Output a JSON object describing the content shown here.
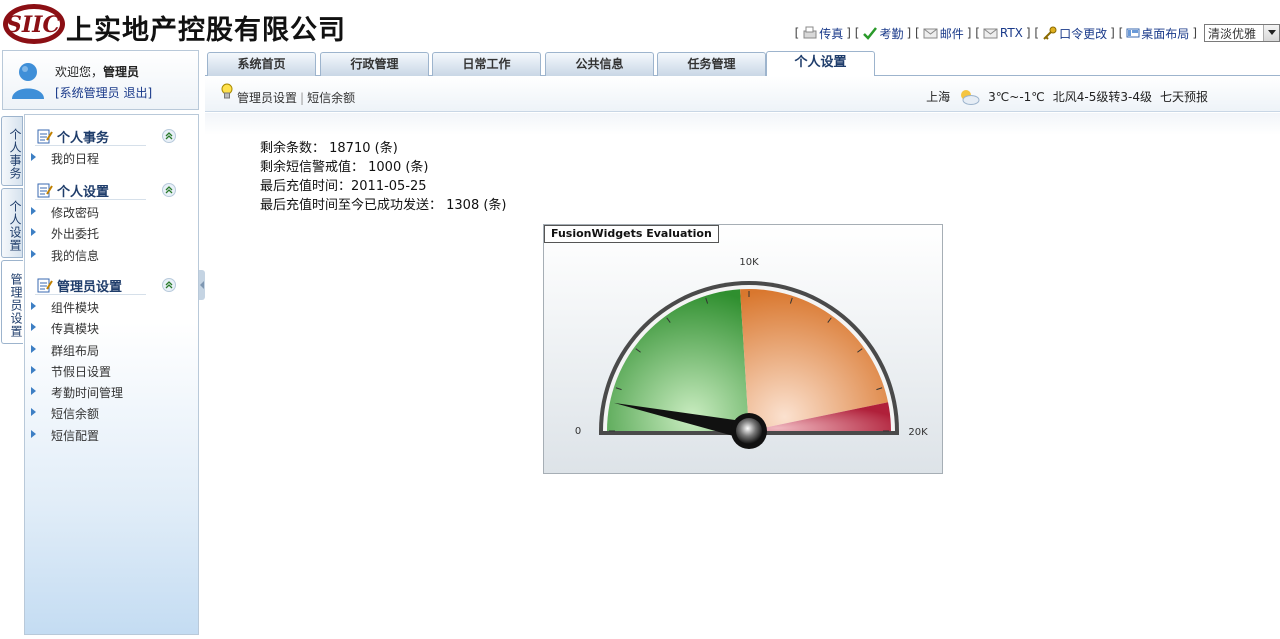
{
  "header": {
    "logo_text": "SIIC",
    "company_name": "上实地产控股有限公司",
    "links": [
      {
        "name": "fax",
        "label": "传真",
        "icon": "fax-icon"
      },
      {
        "name": "attendance",
        "label": "考勤",
        "icon": "check-icon"
      },
      {
        "name": "mail",
        "label": "邮件",
        "icon": "mail-icon"
      },
      {
        "name": "rtx",
        "label": "RTX",
        "icon": "mail-icon"
      },
      {
        "name": "password",
        "label": "口令更改",
        "icon": "key-icon"
      },
      {
        "name": "desktop-layout",
        "label": "桌面布局",
        "icon": "layout-icon"
      }
    ],
    "theme_select": "清淡优雅"
  },
  "user": {
    "welcome": "欢迎您，",
    "name": "管理员",
    "role_link": "[系统管理员",
    "logout": "退出]"
  },
  "tabs": [
    {
      "label": "系统首页",
      "active": false
    },
    {
      "label": "行政管理",
      "active": false
    },
    {
      "label": "日常工作",
      "active": false
    },
    {
      "label": "公共信息",
      "active": false
    },
    {
      "label": "任务管理",
      "active": false
    },
    {
      "label": "个人设置",
      "active": true
    }
  ],
  "subbar": {
    "links": [
      "管理员设置",
      "短信余额"
    ],
    "weather": {
      "city": "上海",
      "temp": "3℃~-1℃",
      "wind": "北风4-5级转3-4级",
      "forecast": "七天预报"
    }
  },
  "vtabs": [
    "个人事务",
    "个人设置",
    "管理员设置"
  ],
  "menu": [
    {
      "title": "个人事务",
      "items": [
        "我的日程"
      ]
    },
    {
      "title": "个人设置",
      "items": [
        "修改密码",
        "外出委托",
        "我的信息"
      ]
    },
    {
      "title": "管理员设置",
      "items": [
        "组件模块",
        "传真模块",
        "群组布局",
        "节假日设置",
        "考勤时间管理",
        "短信余额",
        "短信配置"
      ]
    }
  ],
  "content": {
    "lines": [
      "剩余条数： 18710 (条)",
      "剩余短信警戒值： 1000 (条)",
      "最后充值时间：2011-05-25",
      "最后充值时间至今已成功发送： 1308 (条)"
    ],
    "gauge": {
      "eval_label": "FusionWidgets Evaluation",
      "min_label": "0",
      "mid_label": "10K",
      "max_label": "20K",
      "min": 0,
      "max": 20000,
      "value": 1308,
      "bands": [
        {
          "from": 0,
          "to": 9600,
          "color": "#3a9a3a"
        },
        {
          "from": 9600,
          "to": 18700,
          "color": "#e08a45"
        },
        {
          "from": 18700,
          "to": 20000,
          "color": "#b8283c"
        }
      ]
    }
  }
}
